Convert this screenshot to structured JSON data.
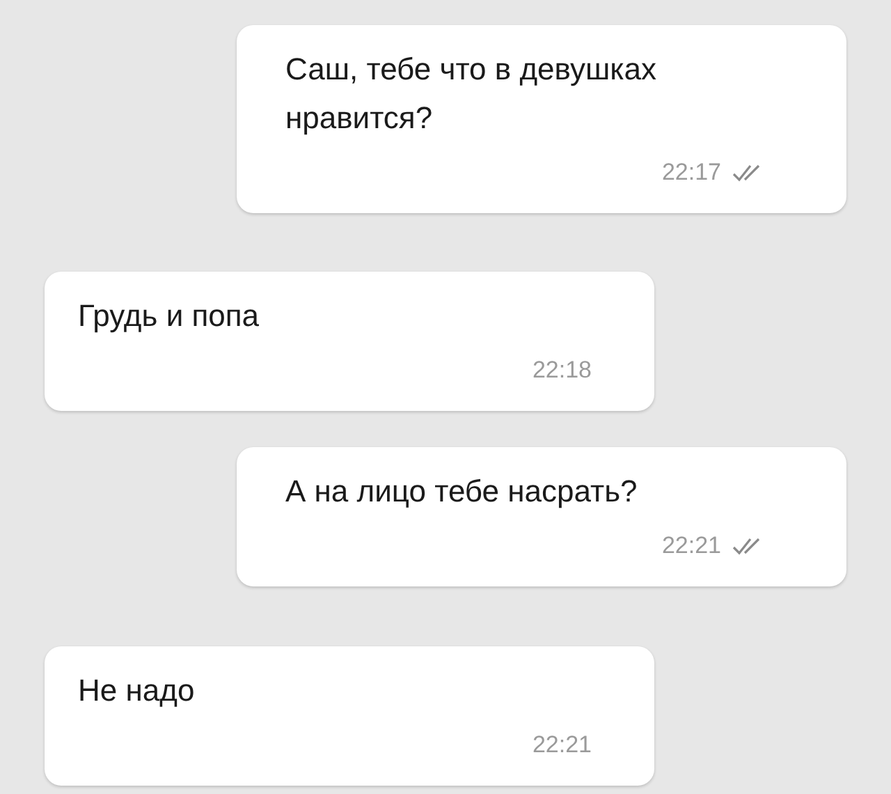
{
  "messages": [
    {
      "kind": "outgoing",
      "text": "Саш, тебе что в девушках нравится?",
      "time": "22:17",
      "read": true
    },
    {
      "kind": "incoming",
      "text": "Грудь и попа",
      "time": "22:18"
    },
    {
      "kind": "outgoing",
      "text": "А на лицо тебе насрать?",
      "time": "22:21",
      "read": true
    },
    {
      "kind": "incoming",
      "text": "Не надо",
      "time": "22:21"
    }
  ]
}
